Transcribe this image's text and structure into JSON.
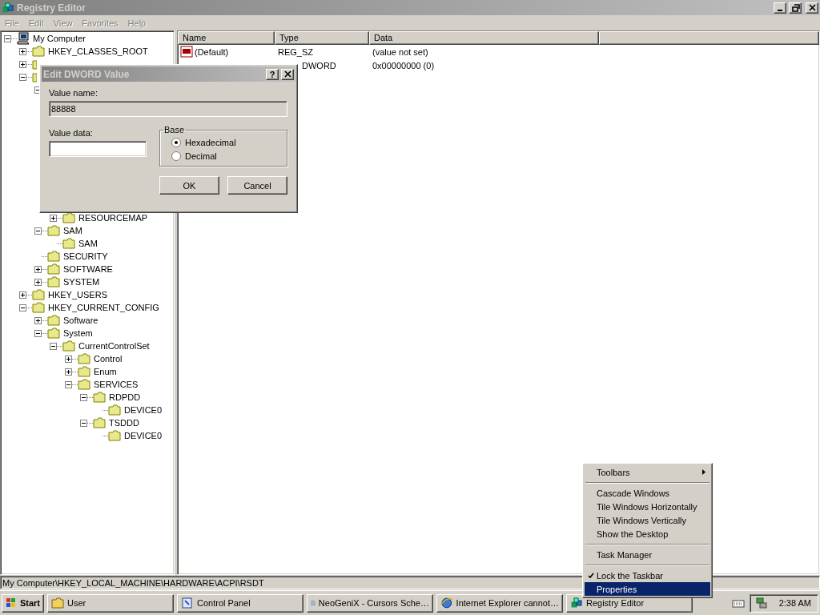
{
  "window": {
    "title": "Registry Editor",
    "active": false
  },
  "menu_bar": [
    {
      "label": "File",
      "disabled": true
    },
    {
      "label": "Edit",
      "disabled": true
    },
    {
      "label": "View",
      "disabled": true
    },
    {
      "label": "Favorites",
      "disabled": true
    },
    {
      "label": "Help",
      "disabled": true
    }
  ],
  "tree": {
    "label": "My Computer",
    "expanded": true,
    "children": [
      {
        "label": "HKEY_CLASSES_ROOT",
        "expanded": false
      },
      {
        "expanded": false
      },
      {
        "expanded": true,
        "children": [
          {
            "expanded": true,
            "children": [
              {
                "covered": true
              },
              {
                "covered": true
              },
              {
                "covered": true
              },
              {
                "covered": true
              },
              {
                "covered": true
              },
              {
                "covered": true
              },
              {
                "covered": true
              },
              {
                "covered": true
              },
              {
                "covered": true
              },
              {
                "label": "RESOURCEMAP",
                "expanded": false
              }
            ]
          },
          {
            "label": "SAM",
            "expanded": true,
            "children": [
              {
                "label": "SAM"
              }
            ]
          },
          {
            "label": "SECURITY"
          },
          {
            "label": "SOFTWARE",
            "expanded": false
          },
          {
            "label": "SYSTEM",
            "expanded": false
          }
        ]
      },
      {
        "label": "HKEY_USERS",
        "expanded": false
      },
      {
        "label": "HKEY_CURRENT_CONFIG",
        "expanded": true,
        "children": [
          {
            "label": "Software",
            "expanded": false
          },
          {
            "label": "System",
            "expanded": true,
            "children": [
              {
                "label": "CurrentControlSet",
                "expanded": true,
                "children": [
                  {
                    "label": "Control",
                    "expanded": false
                  },
                  {
                    "label": "Enum",
                    "expanded": false
                  },
                  {
                    "label": "SERVICES",
                    "expanded": true,
                    "children": [
                      {
                        "label": "RDPDD",
                        "expanded": true,
                        "children": [
                          {
                            "label": "DEVICE0"
                          }
                        ]
                      },
                      {
                        "label": "TSDDD",
                        "expanded": true,
                        "children": [
                          {
                            "label": "DEVICE0"
                          }
                        ]
                      }
                    ]
                  }
                ]
              }
            ]
          }
        ]
      }
    ]
  },
  "values": {
    "columns": [
      "Name",
      "Type",
      "Data"
    ],
    "rows": [
      {
        "name": "(Default)",
        "type": "REG_SZ",
        "data": "(value not set)",
        "covered": false
      },
      {
        "type": "DWORD",
        "data": "0x00000000 (0)",
        "covered": true
      }
    ]
  },
  "status_bar": "My Computer\\HKEY_LOCAL_MACHINE\\HARDWARE\\ACPI\\RSDT",
  "dialog": {
    "title": "Edit DWORD Value",
    "help": "?",
    "value_name_label": "Value name:",
    "value_name": "88888",
    "value_data_label": "Value data:",
    "base_label": "Base",
    "base_options": [
      {
        "label": "Hexadecimal",
        "selected": true
      },
      {
        "label": "Decimal",
        "selected": false
      }
    ],
    "buttons": [
      "OK",
      "Cancel"
    ]
  },
  "taskbar": {
    "start": "Start",
    "buttons": [
      {
        "label": "User",
        "kind": "folder"
      },
      {
        "label": "Control Panel",
        "kind": "control"
      },
      {
        "label": "NeoGeniX - Cursors Sche…",
        "kind": "document"
      },
      {
        "label": "Internet Explorer cannot…",
        "kind": "browser"
      },
      {
        "label": "Registry Editor",
        "kind": "registry"
      }
    ],
    "clock": "2:38 AM"
  },
  "context_menu": [
    {
      "kind": "item",
      "label": "Toolbars",
      "submenu": true,
      "checked": false,
      "selected": false
    },
    {
      "kind": "separator"
    },
    {
      "kind": "item",
      "label": "Cascade Windows",
      "submenu": false,
      "checked": false,
      "selected": false
    },
    {
      "kind": "item",
      "label": "Tile Windows Horizontally",
      "submenu": false,
      "checked": false,
      "selected": false
    },
    {
      "kind": "item",
      "label": "Tile Windows Vertically",
      "submenu": false,
      "checked": false,
      "selected": false
    },
    {
      "kind": "item",
      "label": "Show the Desktop",
      "submenu": false,
      "checked": false,
      "selected": false
    },
    {
      "kind": "separator"
    },
    {
      "kind": "item",
      "label": "Task Manager",
      "submenu": false,
      "checked": false,
      "selected": false
    },
    {
      "kind": "separator"
    },
    {
      "kind": "item",
      "label": "Lock the Taskbar",
      "submenu": false,
      "checked": true,
      "selected": false
    },
    {
      "kind": "item",
      "label": "Properties",
      "submenu": false,
      "checked": false,
      "selected": true
    }
  ]
}
